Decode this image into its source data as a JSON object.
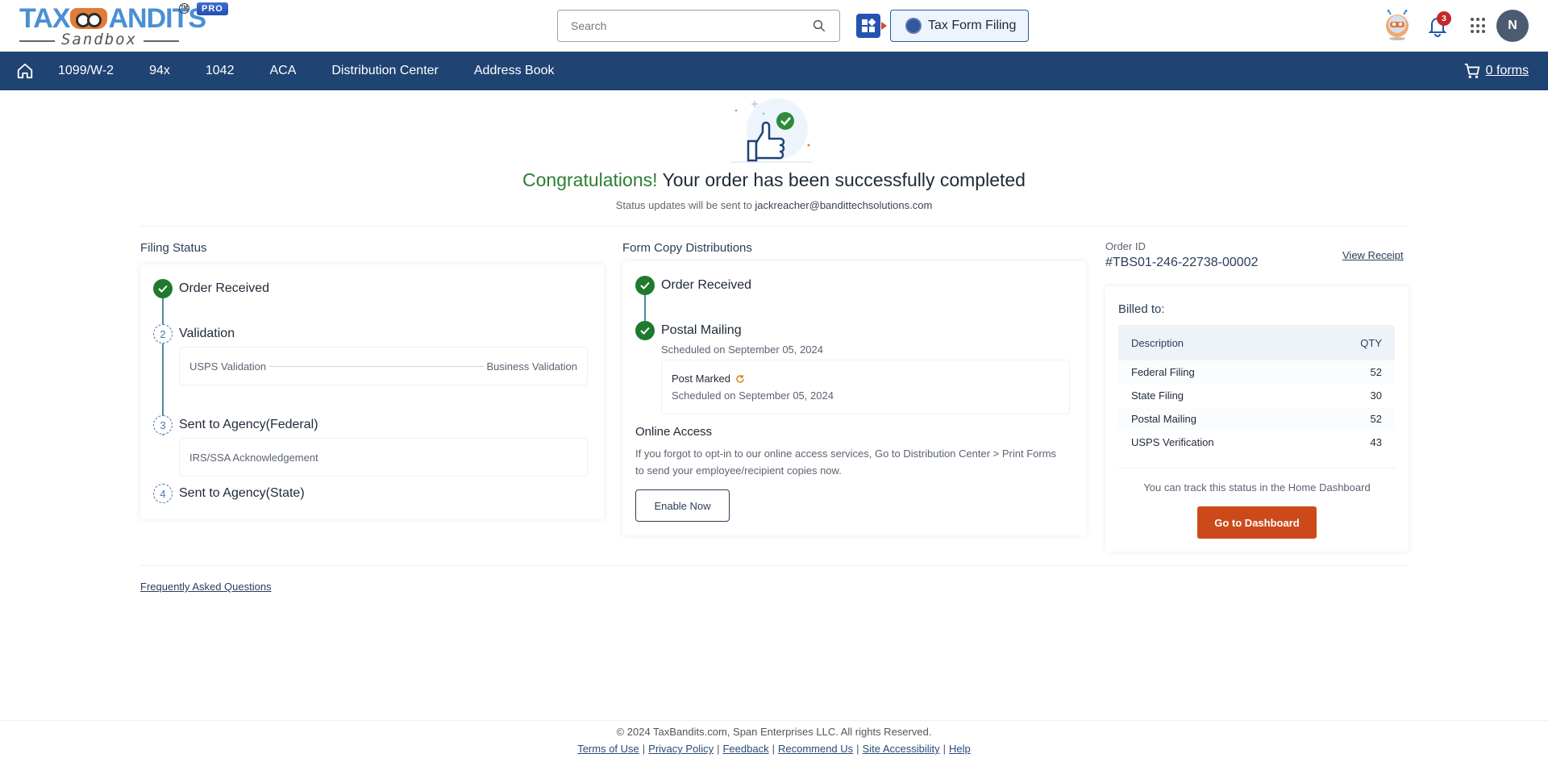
{
  "header": {
    "logo_text_left": "TAX",
    "logo_text_right": "ANDITS",
    "logo_sub": "Sandbox",
    "pro_badge": "PRO",
    "search_placeholder": "Search",
    "product_button": "Tax Form Filing",
    "notification_count": "3",
    "avatar_initial": "N"
  },
  "nav": {
    "items": [
      "1099/W-2",
      "94x",
      "1042",
      "ACA",
      "Distribution Center",
      "Address Book"
    ],
    "cart_label": "0 forms"
  },
  "hero": {
    "congrats": "Congratulations!",
    "title_rest": " Your order has been successfully completed",
    "sub_prefix": "Status updates will be sent to ",
    "email": "jackreacher@bandittechsolutions.com"
  },
  "filing_status": {
    "title": "Filing Status",
    "steps": [
      {
        "num": "1",
        "label": "Order Received",
        "state": "done"
      },
      {
        "num": "2",
        "label": "Validation",
        "state": "pending",
        "sub_left": "USPS Validation",
        "sub_right": "Business Validation"
      },
      {
        "num": "3",
        "label": "Sent to Agency(Federal)",
        "state": "pending",
        "sub": "IRS/SSA Acknowledgement"
      },
      {
        "num": "4",
        "label": "Sent to Agency(State)",
        "state": "pending"
      }
    ]
  },
  "distribution": {
    "title": "Form Copy Distributions",
    "steps": [
      {
        "label": "Order Received",
        "state": "done"
      },
      {
        "label": "Postal Mailing",
        "state": "done",
        "sub": "Scheduled on September 05, 2024"
      }
    ],
    "post_marked": {
      "label": "Post Marked",
      "sub": "Scheduled on September 05, 2024"
    },
    "online_access": {
      "title": "Online Access",
      "text": "If you forgot to opt-in to our online access services, Go to Distribution Center > Print Forms to send your employee/recipient copies now.",
      "button": "Enable Now"
    }
  },
  "order": {
    "id_label": "Order ID",
    "id": "#TBS01-246-22738-00002",
    "view_receipt": "View Receipt",
    "billed_to": "Billed to:",
    "table": {
      "headers": [
        "Description",
        "QTY"
      ],
      "rows": [
        [
          "Federal Filing",
          "52"
        ],
        [
          "State Filing",
          "30"
        ],
        [
          "Postal Mailing",
          "52"
        ],
        [
          "USPS Verification",
          "43"
        ]
      ]
    },
    "track_text": "You can track this status in the Home Dashboard",
    "dashboard_button": "Go to Dashboard"
  },
  "faq_link": "Frequently Asked Questions",
  "footer": {
    "copyright": "© 2024 TaxBandits.com, Span Enterprises LLC. All rights Reserved.",
    "links": [
      "Terms of Use",
      "Privacy Policy",
      "Feedback",
      "Recommend Us",
      "Site Accessibility",
      "Help"
    ]
  },
  "colors": {
    "nav_bg": "#1f4373",
    "success_green": "#1f7a2e",
    "primary_orange": "#cc4a1a",
    "brand_blue": "#4a8fd6"
  }
}
